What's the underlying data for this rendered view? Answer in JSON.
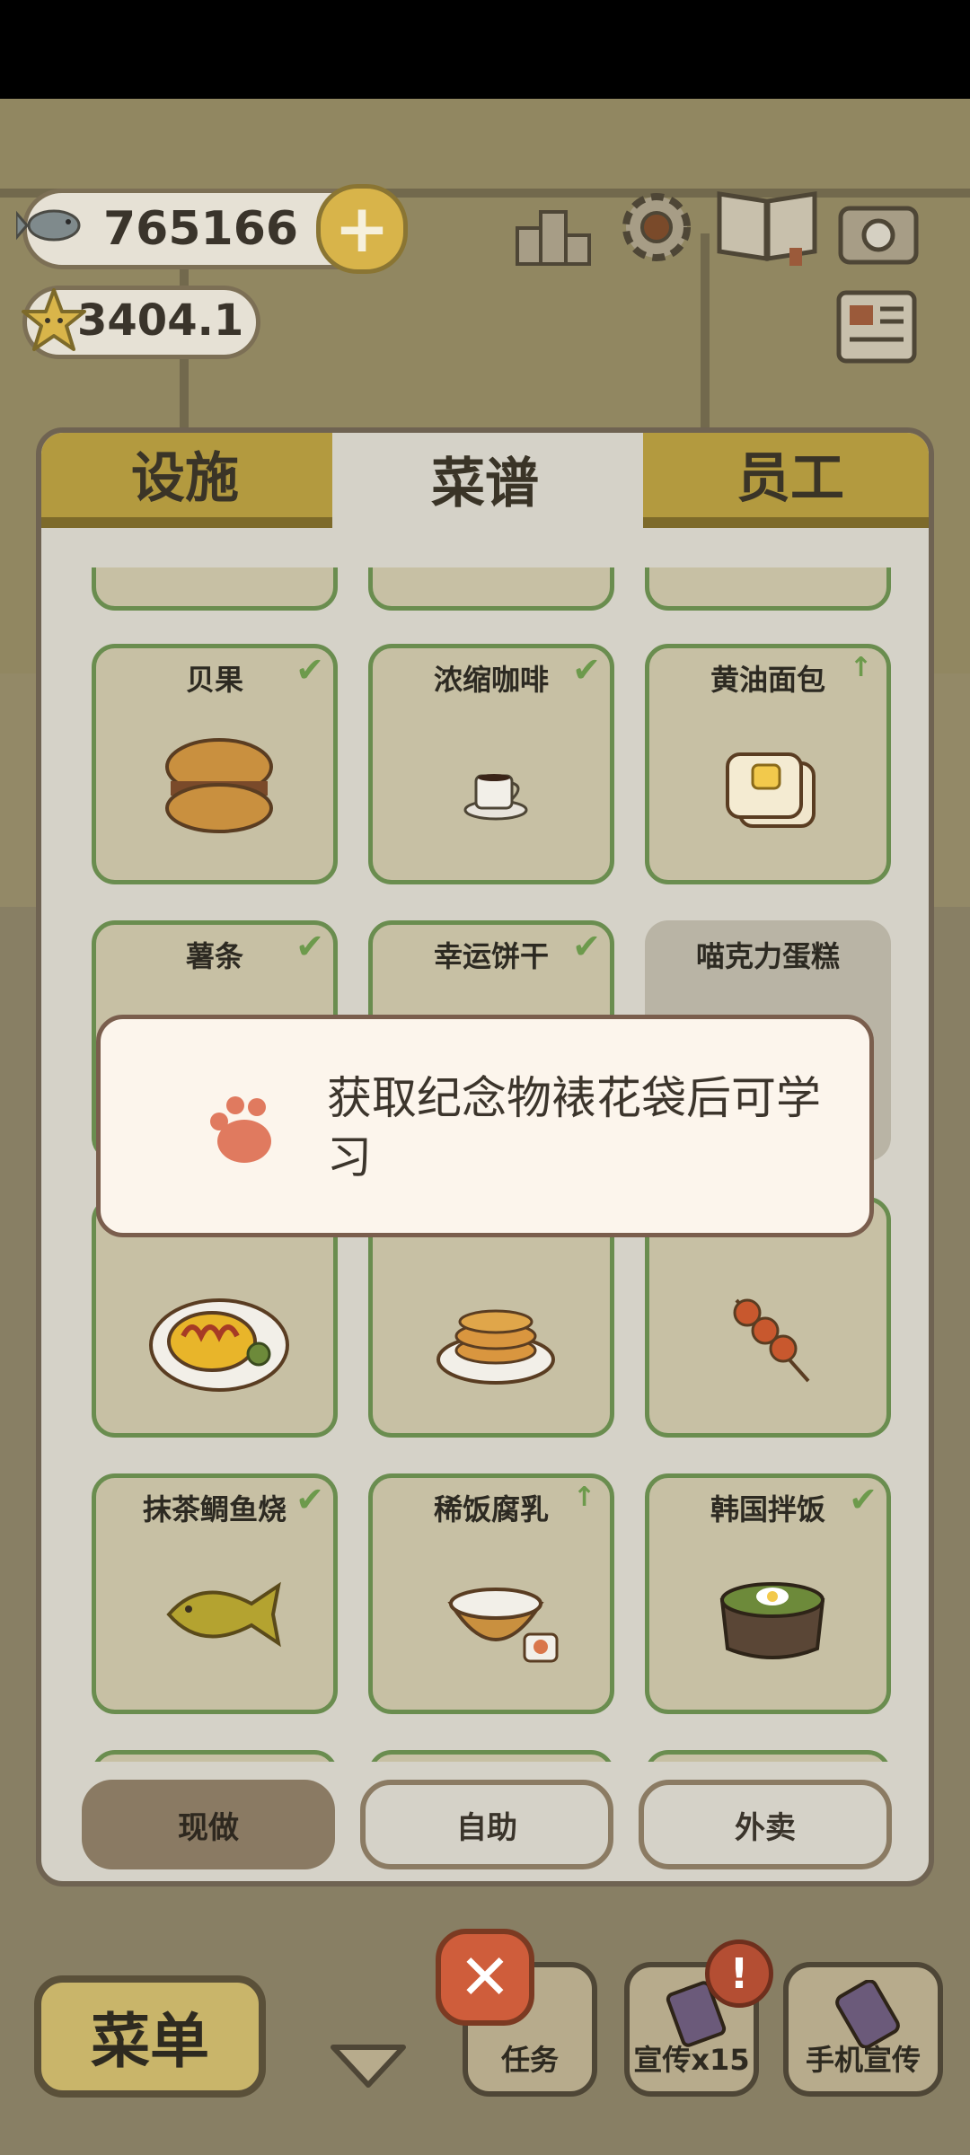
{
  "hud": {
    "fish_count": "765166",
    "star_rating": "3404.1",
    "icons": [
      "fish-icon",
      "plus-icon",
      "star-icon",
      "ranking-icon",
      "settings-gear-icon",
      "recipe-book-icon",
      "camera-icon",
      "newspaper-icon"
    ]
  },
  "tabs": [
    {
      "label": "设施",
      "active": false
    },
    {
      "label": "菜谱",
      "active": true
    },
    {
      "label": "员工",
      "active": false
    }
  ],
  "recipes": [
    {
      "name": "贝果",
      "status": "check",
      "icon": "bagel-icon"
    },
    {
      "name": "浓缩咖啡",
      "status": "check",
      "icon": "espresso-icon"
    },
    {
      "name": "黄油面包",
      "status": "upgrade",
      "icon": "butter-bread-icon"
    },
    {
      "name": "薯条",
      "status": "check",
      "icon": "fries-icon"
    },
    {
      "name": "幸运饼干",
      "status": "check",
      "icon": "fortune-cookie-icon"
    },
    {
      "name": "喵克力蛋糕",
      "status": "locked",
      "icon": "cat-cake-icon"
    },
    {
      "name": "",
      "status": "none",
      "icon": "omurice-icon"
    },
    {
      "name": "",
      "status": "none",
      "icon": "pancake-icon"
    },
    {
      "name": "",
      "status": "none",
      "icon": "dango-skewer-icon"
    },
    {
      "name": "抹茶鲷鱼烧",
      "status": "check",
      "icon": "taiyaki-icon"
    },
    {
      "name": "稀饭腐乳",
      "status": "upgrade",
      "icon": "porridge-icon"
    },
    {
      "name": "韩国拌饭",
      "status": "check",
      "icon": "bibimbap-icon"
    }
  ],
  "modes": [
    {
      "label": "现做",
      "selected": true
    },
    {
      "label": "自助",
      "selected": false
    },
    {
      "label": "外卖",
      "selected": false
    }
  ],
  "dialog": {
    "message": "获取纪念物裱花袋后可学习",
    "icon": "paw-icon"
  },
  "bottom": {
    "menu_label": "菜单",
    "tasks_label": "任务",
    "promo_label": "宣传x15",
    "phone_promo_label": "手机宣传",
    "notification_mark": "!"
  },
  "colors": {
    "accent_gold": "#b39a3f",
    "card_border": "#6a8d4f",
    "close_red": "#cf5d3b",
    "paw": "#e07a5f"
  }
}
